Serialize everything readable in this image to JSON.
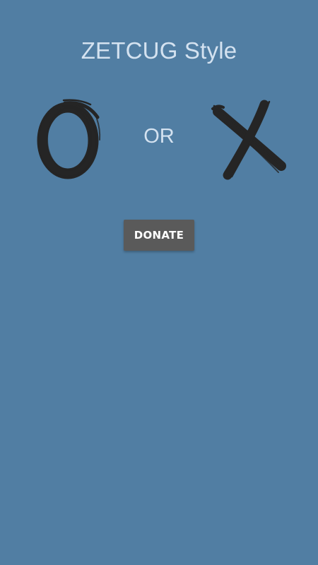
{
  "screen": {
    "title": "ZETCUG Style",
    "or_label": "OR",
    "donate_label": "DONATE"
  },
  "choices": {
    "o": "brush-o-icon",
    "x": "brush-x-icon"
  },
  "colors": {
    "background": "#517EA3",
    "title_text": "#D4E2F0",
    "button_bg": "#5A5A5A",
    "button_text": "#FFFFFF",
    "brush_ink": "#252525"
  }
}
